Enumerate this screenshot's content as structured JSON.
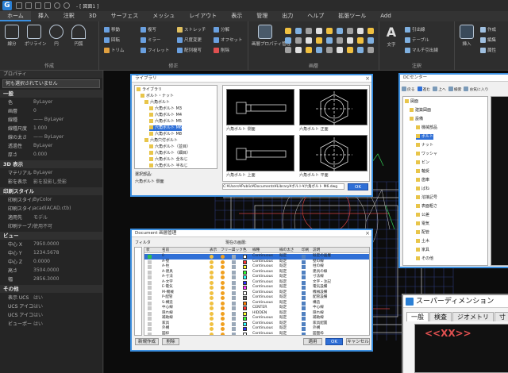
{
  "titlebar": {
    "logo": "G",
    "title": "- [ 図面1 ]"
  },
  "menubar": {
    "tabs": [
      {
        "label": "ホーム",
        "active": true
      },
      {
        "label": "挿入"
      },
      {
        "label": "注釈"
      },
      {
        "label": "3D"
      },
      {
        "label": "サーフェス"
      },
      {
        "label": "メッシュ"
      },
      {
        "label": "レイアウト"
      },
      {
        "label": "表示"
      },
      {
        "label": "管理"
      },
      {
        "label": "出力"
      },
      {
        "label": "ヘルプ"
      },
      {
        "label": "拡張ツール"
      },
      {
        "label": "Add"
      }
    ]
  },
  "ribbon": {
    "draw": {
      "label": "作成",
      "buttons": [
        "線分",
        "ポリライン",
        "円",
        "円弧"
      ]
    },
    "modify": {
      "label": "修正",
      "items": [
        "移動",
        "回転",
        "トリム",
        "複写",
        "ミラー",
        "フィレット",
        "ストレッチ",
        "尺度変更",
        "配列複写",
        "分解",
        "オフセット",
        "削除"
      ]
    },
    "layers": {
      "label": "画層",
      "buttons": [
        "画層プロパティ管理"
      ]
    },
    "annotation": {
      "label": "注釈",
      "buttons": [
        "文字",
        "寸法"
      ],
      "items": [
        "引出線",
        "テーブル",
        "マルチ引出線"
      ]
    },
    "block": {
      "buttons": [
        "挿入"
      ],
      "items": [
        "作成",
        "編集",
        "属性"
      ]
    }
  },
  "properties": {
    "title": "プロパティ",
    "selection": "何も選択されていません",
    "sections": [
      {
        "title": "一般",
        "rows": [
          [
            "色",
            "ByLayer"
          ],
          [
            "画層",
            "0"
          ],
          [
            "線種",
            "—— ByLayer"
          ],
          [
            "線種尺度",
            "1.000"
          ],
          [
            "線の太さ",
            "—— ByLayer"
          ],
          [
            "透過性",
            "ByLayer"
          ],
          [
            "厚さ",
            "0.000"
          ]
        ]
      },
      {
        "title": "3D 表示",
        "rows": [
          [
            "マテリアル",
            "ByLayer"
          ],
          [
            "影を表示",
            "影を投影し受影"
          ]
        ]
      },
      {
        "title": "印刷スタイル",
        "rows": [
          [
            "印刷スタイル",
            "ByColor"
          ],
          [
            "印刷スタイル",
            "acad(ACAD.ctb)"
          ],
          [
            "適用先",
            "モデル"
          ],
          [
            "印刷テーブル",
            "使用不可"
          ]
        ]
      },
      {
        "title": "ビュー",
        "rows": [
          [
            "中心 X",
            "7950.0000"
          ],
          [
            "中心 Y",
            "1234.5678"
          ],
          [
            "中心 Z",
            "0.0000"
          ],
          [
            "高さ",
            "3504.0000"
          ],
          [
            "幅",
            "2856.3000"
          ]
        ]
      },
      {
        "title": "その他",
        "rows": [
          [
            "表示 UCS",
            "はい"
          ],
          [
            "UCS アイコン",
            "はい"
          ],
          [
            "UCS アイコン",
            "はい"
          ],
          [
            "ビューポート",
            "はい"
          ]
        ]
      }
    ]
  },
  "dlg_library": {
    "title": "ライブラリ",
    "tree": [
      "ライブラリ",
      "ボルト・ナット",
      "六角ボルト",
      "六角ボルト M3",
      "六角ボルト M4",
      "六角ボルト M5",
      "六角ボルト M6",
      "六角ボルト M8",
      "六角穴付ボルト",
      "六角ボルト（並目）",
      "六角ボルト（細目）",
      "六角ボルト 全ねじ",
      "六角ボルト 半ねじ"
    ],
    "thumbs": [
      "六角ボルト 側面",
      "六角ボルト 正面",
      "六角ボルト 上面",
      "六角ボルト 平面"
    ],
    "path_label": "選択部品:",
    "path": "C:¥Users¥Public¥Documents¥Library¥ボルト¥六角ボルト M6.dwg",
    "item_label": "六角ボルト 側面",
    "ok": "OK"
  },
  "dlg_tree": {
    "title": "DCセンター",
    "toolbar": [
      "戻る",
      "進む",
      "上へ",
      "検索",
      "お気に入り"
    ],
    "items": [
      "図面",
      "建築図面",
      "設備",
      "機械部品",
      "ボルト",
      "ナット",
      "ワッシャ",
      "ピン",
      "軸受",
      "歯車",
      "ばね",
      "溶接記号",
      "表面粗さ",
      "公差",
      "電気",
      "配管",
      "土木",
      "家具",
      "その他"
    ]
  },
  "dlg_layers": {
    "title": "Document 画層管理",
    "filter_label": "フィルタ",
    "current_label": "現在の画層:",
    "headers": [
      "状",
      "名前",
      "表示",
      "フリーズ",
      "ロック",
      "色",
      "線種",
      "線の太さ",
      "印刷",
      "説明"
    ],
    "rows": [
      [
        "0",
        "Continuous",
        "既定"
      ],
      [
        "A-壁",
        "Continuous",
        "既定"
      ],
      [
        "A-柱",
        "Continuous",
        "既定"
      ],
      [
        "A-建具",
        "Continuous",
        "既定"
      ],
      [
        "A-寸法",
        "Continuous",
        "既定"
      ],
      [
        "A-文字",
        "Continuous",
        "既定"
      ],
      [
        "E-電気",
        "Continuous",
        "既定"
      ],
      [
        "M-機械",
        "Continuous",
        "既定"
      ],
      [
        "P-配管",
        "Continuous",
        "既定"
      ],
      [
        "S-構造",
        "Continuous",
        "既定"
      ],
      [
        "中心線",
        "CENTER",
        "既定"
      ],
      [
        "隠れ線",
        "HIDDEN",
        "既定"
      ],
      [
        "補助線",
        "Continuous",
        "既定"
      ],
      [
        "家具",
        "Continuous",
        "既定"
      ],
      [
        "外構",
        "Continuous",
        "既定"
      ],
      [
        "図枠",
        "Continuous",
        "既定"
      ]
    ],
    "descriptions": [
      "既定の画層",
      "壁の線",
      "柱の線",
      "建具の線",
      "寸法線",
      "文字・注記",
      "電気設備",
      "機械設備",
      "配管設備",
      "構造",
      "中心線",
      "隠れ線",
      "補助線",
      "家具配置",
      "外構",
      "図面枠"
    ],
    "btn_new": "新規作成",
    "btn_delete": "削除",
    "btn_apply": "適用",
    "btn_ok": "OK",
    "btn_cancel": "キャンセル"
  },
  "dlg_superdim": {
    "title": "スーパーディメンション",
    "tabs": [
      "一般",
      "検査",
      "ジオメトリ",
      "寸"
    ],
    "preview_text": "<<XX>>"
  }
}
